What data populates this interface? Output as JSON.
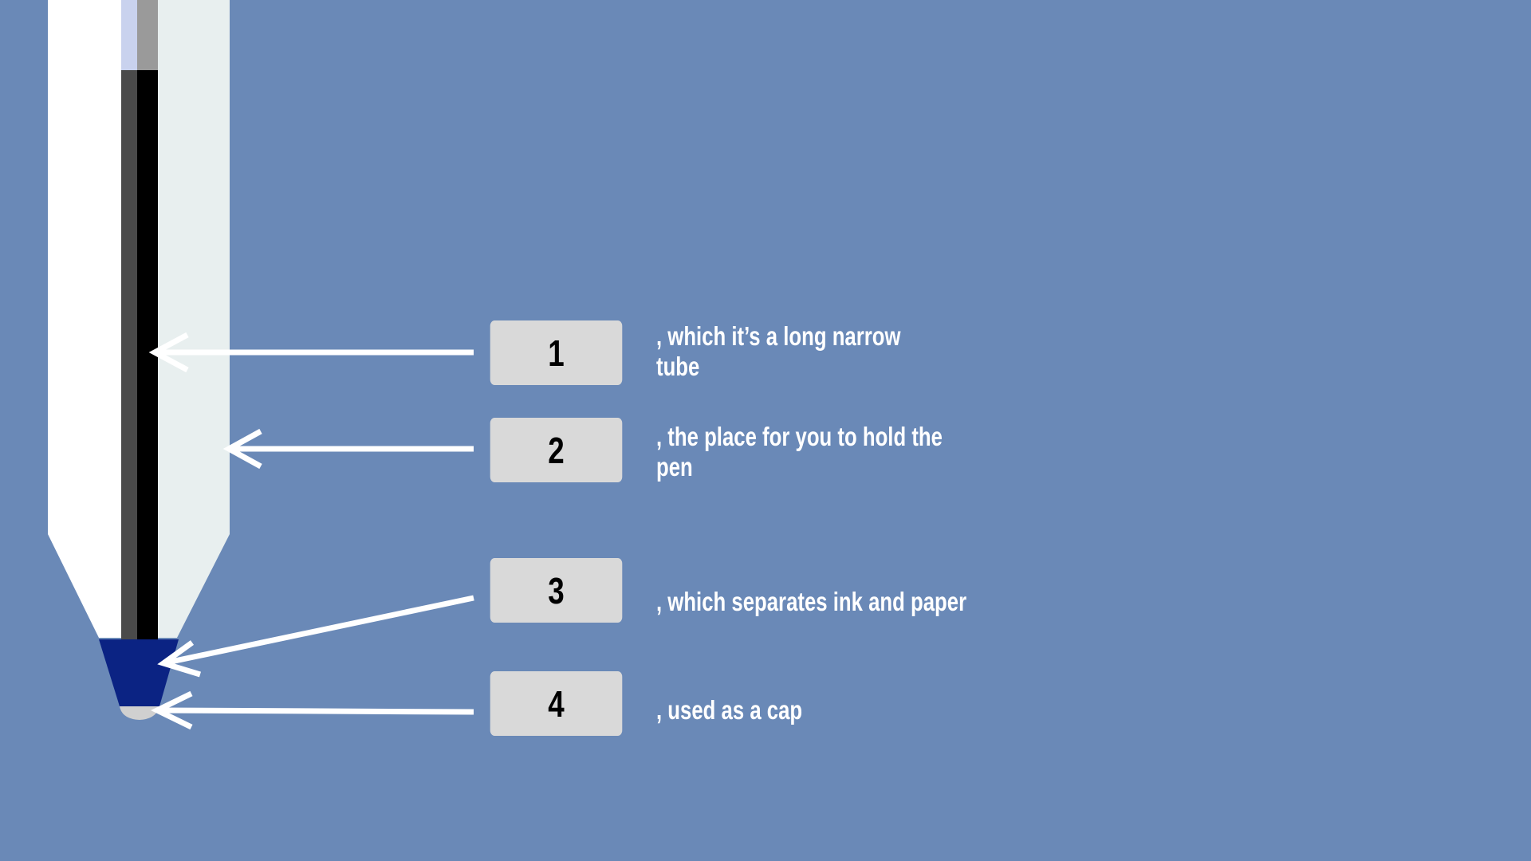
{
  "labels": [
    {
      "number": "1",
      "text": ", which it’s a long narrow\ntube"
    },
    {
      "number": "2",
      "text": ", the place for you to hold the\npen"
    },
    {
      "number": "3",
      "text": ", which separates ink and paper"
    },
    {
      "number": "4",
      "text": ", used as a cap"
    }
  ],
  "colors": {
    "background": "#6a89b7",
    "barrel_left": "#ffffff",
    "barrel_right": "#e8efef",
    "refill_dark": "#4a4a4a",
    "refill_black": "#000000",
    "refill_top_left": "#c9d2ee",
    "refill_top_right": "#9a9a9a",
    "tip_cone": "#0b2383",
    "ball": "#d0d0d0",
    "label_box": "#d9d9d9",
    "arrows": "#ffffff",
    "text": "#ffffff"
  }
}
